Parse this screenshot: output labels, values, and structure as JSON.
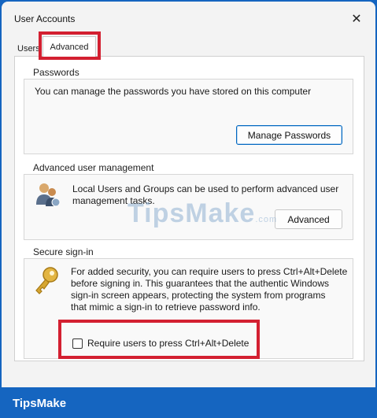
{
  "window": {
    "title": "User Accounts",
    "close_glyph": "✕"
  },
  "tabs": [
    {
      "label": "Users"
    },
    {
      "label": "Advanced"
    }
  ],
  "passwords": {
    "heading": "Passwords",
    "text": "You can manage the passwords you have stored on this computer",
    "button": "Manage Passwords"
  },
  "advanced_user": {
    "heading": "Advanced user management",
    "text_line1": "Local Users and Groups can be used to perform advanced user",
    "text_line2": "management tasks.",
    "button": "Advanced"
  },
  "secure_signin": {
    "heading": "Secure sign-in",
    "text_line1": "For added security, you can require users to press Ctrl+Alt+Delete",
    "text_line2": "before signing in. This guarantees that the authentic Windows",
    "text_line3": "sign-in screen appears, protecting the system from programs",
    "text_line4": "that mimic a sign-in to retrieve password info.",
    "checkbox_label": "Require users to press Ctrl+Alt+Delete",
    "checkbox_checked": false
  },
  "watermark": {
    "text": "TipsMake",
    "suffix": ".com"
  },
  "footer": {
    "brand": "TipsMake"
  },
  "colors": {
    "highlight": "#d32031",
    "footer_bg": "#1565c0"
  }
}
